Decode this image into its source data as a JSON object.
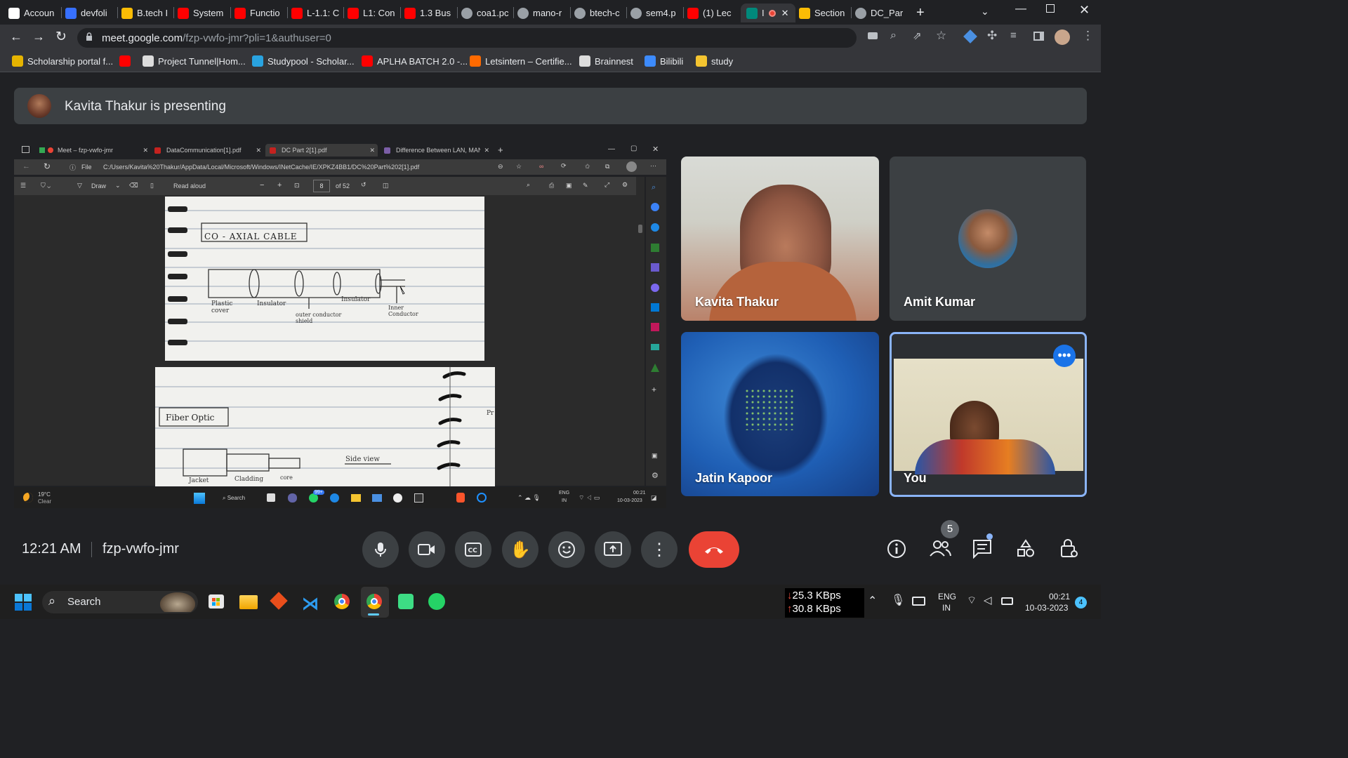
{
  "chrome": {
    "tabs": [
      {
        "label": "Accoun",
        "icon": "wordpress-icon"
      },
      {
        "label": "devfoli",
        "icon": "devfolio-icon"
      },
      {
        "label": "B.tech I",
        "icon": "drive-icon"
      },
      {
        "label": "System",
        "icon": "youtube-icon"
      },
      {
        "label": "Functio",
        "icon": "youtube-icon"
      },
      {
        "label": "L-1.1: C",
        "icon": "youtube-icon"
      },
      {
        "label": "L1: Con",
        "icon": "youtube-icon"
      },
      {
        "label": "1.3 Bus",
        "icon": "youtube-icon"
      },
      {
        "label": "coa1.pc",
        "icon": "globe-icon"
      },
      {
        "label": "mano-r",
        "icon": "globe-icon"
      },
      {
        "label": "btech-c",
        "icon": "globe-icon"
      },
      {
        "label": "sem4.p",
        "icon": "globe-icon"
      },
      {
        "label": "(1) Lec",
        "icon": "youtube-icon"
      },
      {
        "label": "I",
        "icon": "meet-icon"
      },
      {
        "label": "Section",
        "icon": "drive-icon"
      },
      {
        "label": "DC_Par",
        "icon": "globe-icon"
      }
    ],
    "url_main": "meet.google.com",
    "url_path": "/fzp-vwfo-jmr?pli=1&authuser=0",
    "bookmarks": [
      "Scholarship portal f...",
      "",
      "Project Tunnel|Hom...",
      "Studypool - Scholar...",
      "APLHA BATCH 2.0 -...",
      "Letsintern – Certifie...",
      "Brainnest",
      "Bilibili",
      "study"
    ]
  },
  "meet": {
    "presenting_text": "Kavita Thakur is presenting",
    "time": "12:21 AM",
    "meeting_code": "fzp-vwfo-jmr",
    "participant_count": "5",
    "participants": [
      {
        "name": "Kavita Thakur"
      },
      {
        "name": "Amit Kumar"
      },
      {
        "name": "Jatin Kapoor"
      },
      {
        "name": "You"
      }
    ]
  },
  "shared": {
    "tabs": [
      "Meet – fzp-vwfo-jmr",
      "DataCommunication[1].pdf",
      "DC Part 2[1].pdf",
      "Difference Between LAN, MAN, a"
    ],
    "file_label": "File",
    "path": "C:/Users/Kavita%20Thakur/AppData/Local/Microsoft/Windows/INetCache/IE/XPKZ4BB1/DC%20Part%202[1].pdf",
    "draw_label": "Draw",
    "read_aloud": "Read aloud",
    "page_num": "8",
    "page_total": "of 52",
    "notes1": {
      "title": "CO - AXIAL  CABLE",
      "labels": [
        "Plastic cover",
        "Insulator",
        "outer conductor shield",
        "Insulator",
        "Inner Conductor"
      ]
    },
    "notes2": {
      "title": "Fiber  Optic",
      "labels": [
        "Side  view",
        "Jacket",
        "Cladding",
        "core",
        "Pr"
      ]
    },
    "weather_temp": "19°C",
    "weather_desc": "Clear",
    "search": "Search",
    "lang1": "ENG",
    "lang2": "IN",
    "time": "00:21",
    "date": "10-03-2023",
    "badge": "99+"
  },
  "taskbar": {
    "search": "Search",
    "net_down": "25.3 KBps",
    "net_up": "30.8 KBps",
    "lang1": "ENG",
    "lang2": "IN",
    "time": "00:21",
    "date": "10-03-2023",
    "notif": "4"
  },
  "colors": {
    "end_call": "#ea4335",
    "meet_bg": "#202124",
    "accent_blue": "#8ab4f8"
  }
}
